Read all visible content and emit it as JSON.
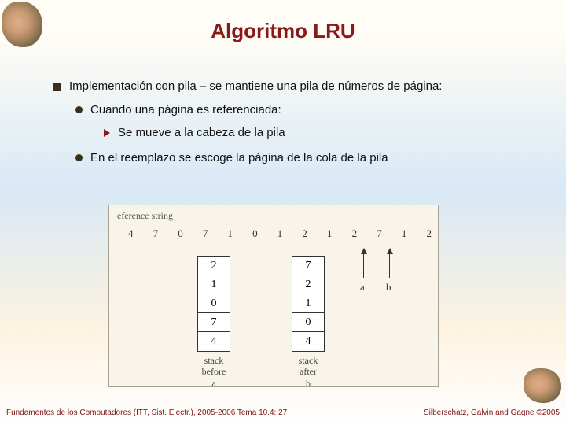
{
  "title": "Algoritmo LRU",
  "bullets": {
    "l1": "Implementación con pila – se mantiene una pila de números de página:",
    "l2a": "Cuando una página es referenciada:",
    "l3": "Se mueve a la cabeza de la pila",
    "l2b": "En el reemplazo se escoge la página de la cola de la pila"
  },
  "diagram": {
    "ref_label": "eference string",
    "ref_string": [
      "4",
      "7",
      "0",
      "7",
      "1",
      "0",
      "1",
      "2",
      "1",
      "2",
      "7",
      "1",
      "2"
    ],
    "stack_a": [
      "2",
      "1",
      "0",
      "7",
      "4"
    ],
    "stack_b": [
      "7",
      "2",
      "1",
      "0",
      "4"
    ],
    "label_a_line1": "stack",
    "label_a_line2": "before",
    "label_a_line3": "a",
    "label_b_line1": "stack",
    "label_b_line2": "after",
    "label_b_line3": "b",
    "arrow_a": "a",
    "arrow_b": "b"
  },
  "footer": {
    "left": "Fundamentos de los Computadores (ITT, Sist. Electr.), 2005-2006   Tema 10.4: 27",
    "right": "Silberschatz, Galvin and Gagne ©2005"
  }
}
